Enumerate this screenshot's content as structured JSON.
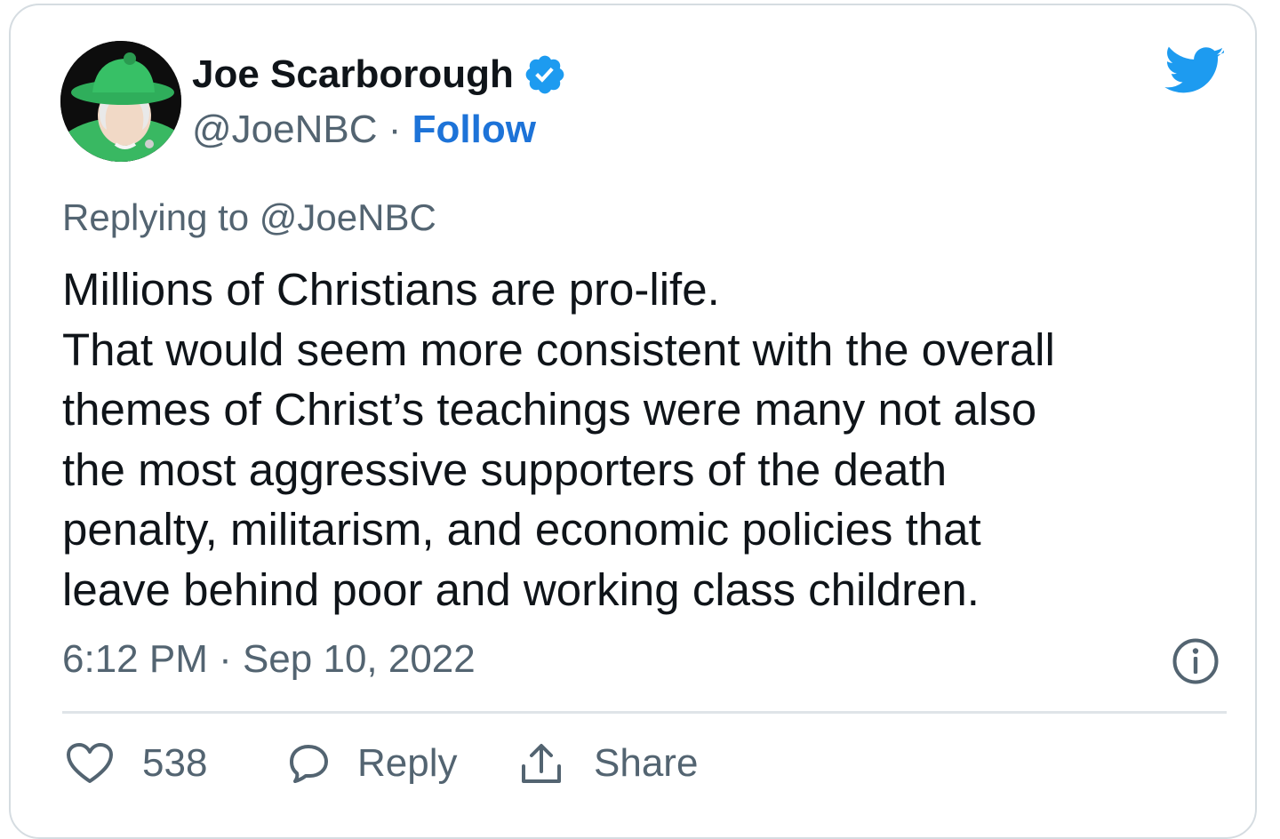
{
  "tweet": {
    "author": {
      "name": "Joe Scarborough",
      "handle": "@JoeNBC",
      "separator": "·",
      "follow_label": "Follow",
      "verified": true,
      "avatar_icon": "profile-avatar"
    },
    "replying": {
      "prefix": "Replying to",
      "mention": "@JoeNBC"
    },
    "text_lines": [
      "Millions of Christians are pro-life.",
      "That would seem more consistent with the overall",
      "themes of Christ’s teachings were many not also",
      "the most aggressive supporters of the death",
      "penalty, militarism, and economic policies that",
      "leave behind poor and working class children."
    ],
    "timestamp": "6:12 PM · Sep 10, 2022",
    "actions": {
      "likes_count": "538",
      "reply_label": "Reply",
      "share_label": "Share"
    }
  },
  "colors": {
    "twitter_blue": "#1d9bf0",
    "follow_blue": "#1d73d8",
    "text_primary": "#0f1419",
    "text_secondary": "#536471",
    "border": "#d5dce1"
  },
  "icons": [
    "twitter-bird-icon",
    "verified-badge-icon",
    "info-icon",
    "heart-icon",
    "reply-bubble-icon",
    "share-icon"
  ]
}
